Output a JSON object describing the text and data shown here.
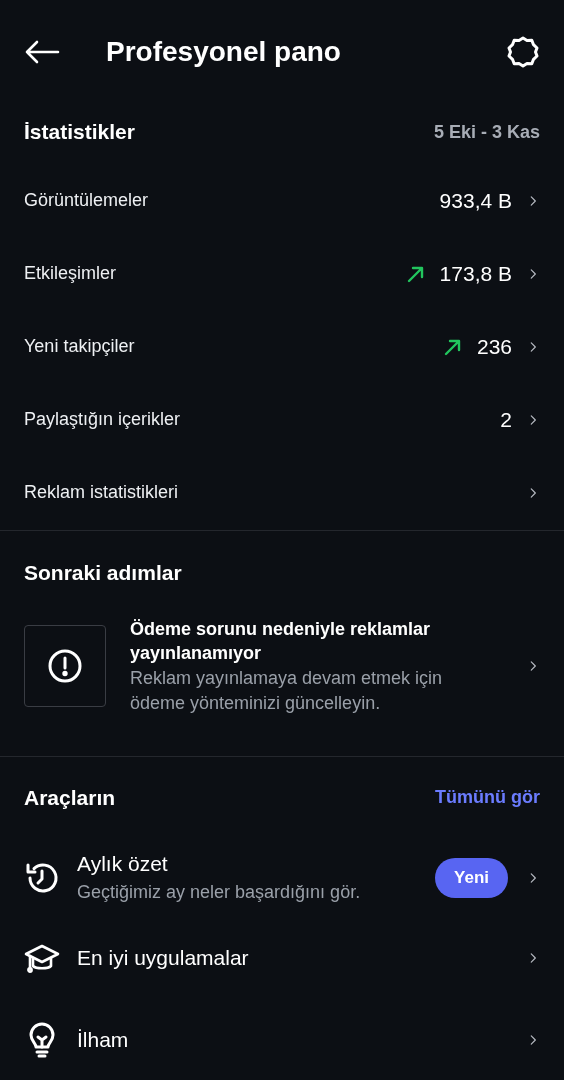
{
  "header": {
    "title": "Profesyonel pano"
  },
  "stats": {
    "title": "İstatistikler",
    "range": "5 Eki - 3 Kas",
    "rows": [
      {
        "label": "Görüntülemeler",
        "value": "933,4 B",
        "trending_up": false
      },
      {
        "label": "Etkileşimler",
        "value": "173,8 B",
        "trending_up": true
      },
      {
        "label": "Yeni takipçiler",
        "value": "236",
        "trending_up": true
      },
      {
        "label": "Paylaştığın içerikler",
        "value": "2",
        "trending_up": false
      },
      {
        "label": "Reklam istatistikleri",
        "trending_up": false
      }
    ]
  },
  "next_steps": {
    "title": "Sonraki adımlar",
    "card": {
      "title": "Ödeme sorunu nedeniyle reklamlar yayınlanamıyor",
      "text": "Reklam yayınlamaya devam etmek için ödeme yönteminizi güncelleyin."
    }
  },
  "tools": {
    "title": "Araçların",
    "see_all": "Tümünü gör",
    "items": [
      {
        "kind": "history",
        "title": "Aylık özet",
        "subtitle": "Geçtiğimiz ay neler başardığını gör.",
        "badge": "Yeni"
      },
      {
        "kind": "cap",
        "title": "En iyi uygulamalar"
      },
      {
        "kind": "bulb",
        "title": "İlham"
      }
    ]
  }
}
